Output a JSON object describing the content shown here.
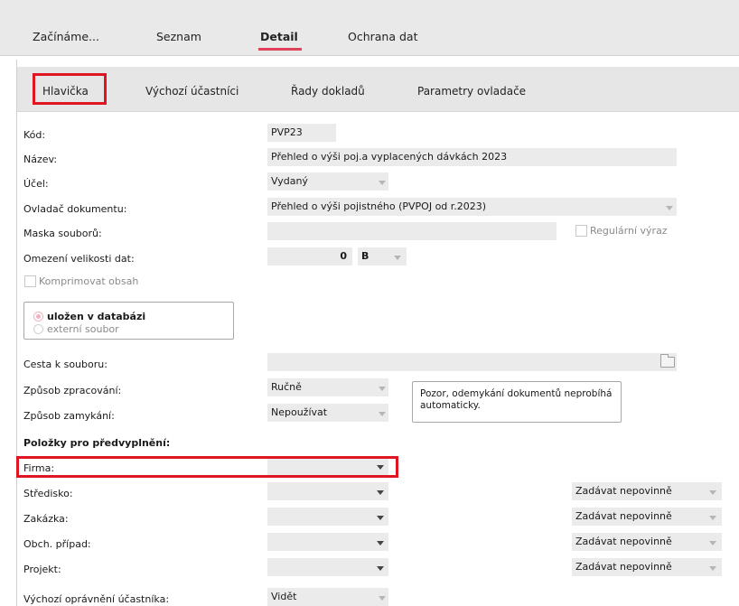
{
  "top_tabs": {
    "zaciname": "Začínáme...",
    "seznam": "Seznam",
    "detail": "Detail",
    "ochrana": "Ochrana dat"
  },
  "sub_tabs": {
    "hlavicka": "Hlavička",
    "vychozi": "Výchozí účastníci",
    "rady": "Řady dokladů",
    "parametry": "Parametry ovladače"
  },
  "form": {
    "kod": {
      "label": "Kód:",
      "value": "PVP23"
    },
    "nazev": {
      "label": "Název:",
      "value": "Přehled o výši poj.a vyplacených dávkách 2023"
    },
    "ucel": {
      "label": "Účel:",
      "value": "Vydaný"
    },
    "ovladac": {
      "label": "Ovladač dokumentu:",
      "value": "Přehled o výši pojistného (PVPOJ od r.2023)"
    },
    "maska": {
      "label": "Maska souborů:",
      "value": "",
      "regex_label": "Regulární výraz"
    },
    "omezeni": {
      "label": "Omezení velikosti dat:",
      "value": "0",
      "unit": "B"
    },
    "komprimovat": "Komprimovat obsah",
    "ulozeni": {
      "db": "uložen v databázi",
      "ext": "externí soubor"
    },
    "cesta": {
      "label": "Cesta k souboru:",
      "value": ""
    },
    "zpracovani": {
      "label": "Způsob zpracování:",
      "value": "Ručně"
    },
    "zamykani": {
      "label": "Způsob zamykání:",
      "value": "Nepoužívat"
    },
    "note": "Pozor, odemykání dokumentů neprobíhá automaticky.",
    "section": "Položky pro předvyplnění:",
    "firma": {
      "label": "Firma:",
      "value": ""
    },
    "stredisko": {
      "label": "Středisko:",
      "value": "",
      "mode": "Zadávat nepovinně"
    },
    "zakazka": {
      "label": "Zakázka:",
      "value": "",
      "mode": "Zadávat nepovinně"
    },
    "obch": {
      "label": "Obch. případ:",
      "value": "",
      "mode": "Zadávat nepovinně"
    },
    "projekt": {
      "label": "Projekt:",
      "value": "",
      "mode": "Zadávat nepovinně"
    },
    "opravneni": {
      "label": "Výchozí oprávnění účastníka:",
      "value": "Vidět"
    }
  },
  "colors": {
    "accent": "#e0415a",
    "highlight_border": "#e01522",
    "field_bg": "#ebebeb"
  }
}
